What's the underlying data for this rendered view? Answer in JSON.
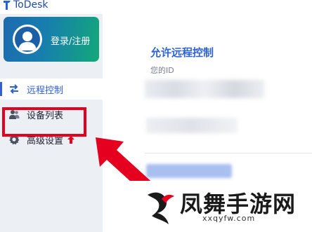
{
  "app": {
    "name": "ToDesk"
  },
  "sidebar": {
    "login_label": "登录/注册",
    "items": [
      {
        "label": "远程控制",
        "icon": "swap-arrows-icon",
        "active": true
      },
      {
        "label": "设备列表",
        "icon": "users-icon",
        "active": false
      },
      {
        "label": "高级设置",
        "icon": "gear-icon",
        "active": false,
        "badge_icon": "update-arrow-icon"
      }
    ]
  },
  "main": {
    "section_title": "允许远程控制",
    "id_label": "您的ID"
  },
  "watermark": {
    "title": "凤舞手游网",
    "domain": "xxqyfw.com"
  },
  "colors": {
    "accent": "#2f5fd0",
    "highlight": "#e5001f",
    "login_gradient_start": "#1d6bb0",
    "login_gradient_end": "#13a879"
  }
}
